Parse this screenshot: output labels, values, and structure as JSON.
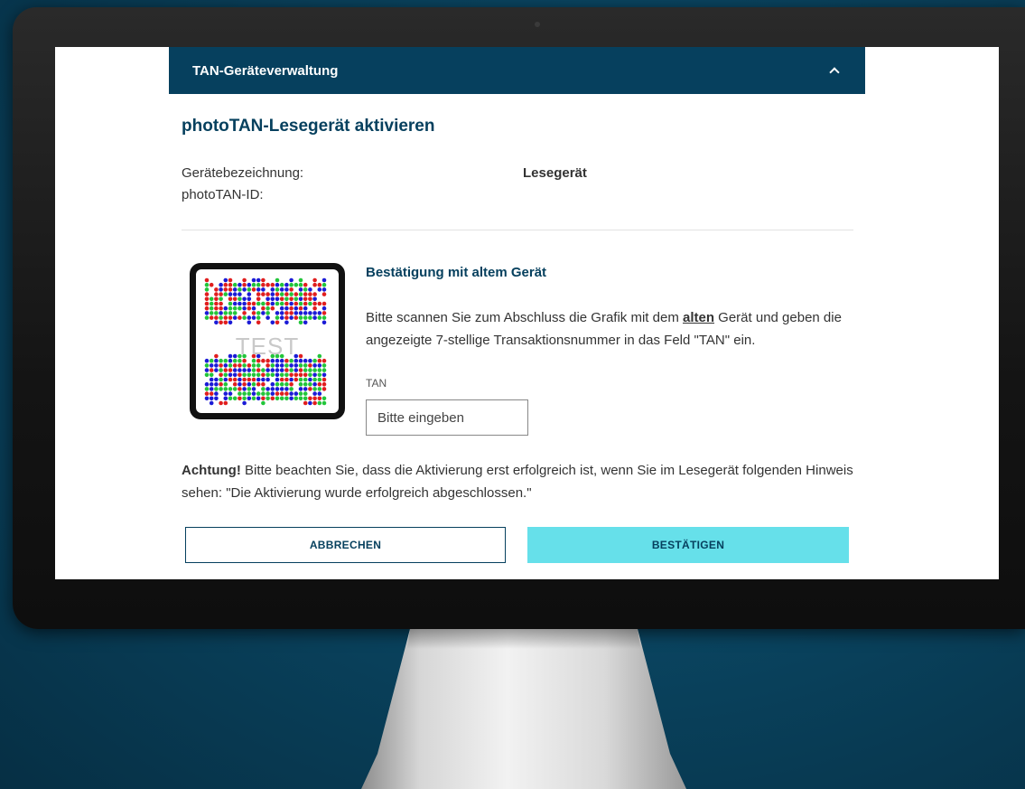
{
  "header": {
    "title": "TAN-Geräteverwaltung"
  },
  "page": {
    "title": "photoTAN-Lesegerät aktivieren"
  },
  "info": {
    "device_name_label": "Gerätebezeichnung:",
    "device_name_value": "Lesegerät",
    "phototan_id_label": "photoTAN-ID:",
    "phototan_id_value": ""
  },
  "qr": {
    "watermark": "TEST",
    "dot_colors": [
      "#1b1bd6",
      "#e01e1e",
      "#22c53a"
    ]
  },
  "confirm_section": {
    "title": "Bestätigung mit altem Gerät",
    "text_part1": "Bitte scannen Sie zum Abschluss die Grafik mit dem ",
    "text_emphasis": "alten",
    "text_part2": " Gerät und geben die angezeigte 7-stellige Transaktionsnummer in das Feld \"TAN\" ein.",
    "tan_label": "TAN",
    "tan_placeholder": "Bitte eingeben",
    "tan_value": ""
  },
  "warning": {
    "bold": "Achtung!",
    "text": " Bitte beachten Sie, dass die Aktivierung erst erfolgreich ist, wenn Sie im Lesegerät folgenden Hinweis sehen: \"Die Aktivierung wurde erfolgreich abgeschlossen.\""
  },
  "buttons": {
    "cancel": "ABBRECHEN",
    "confirm": "BESTÄTIGEN"
  },
  "colors": {
    "brand": "#06405e",
    "accent": "#66e0ea"
  }
}
